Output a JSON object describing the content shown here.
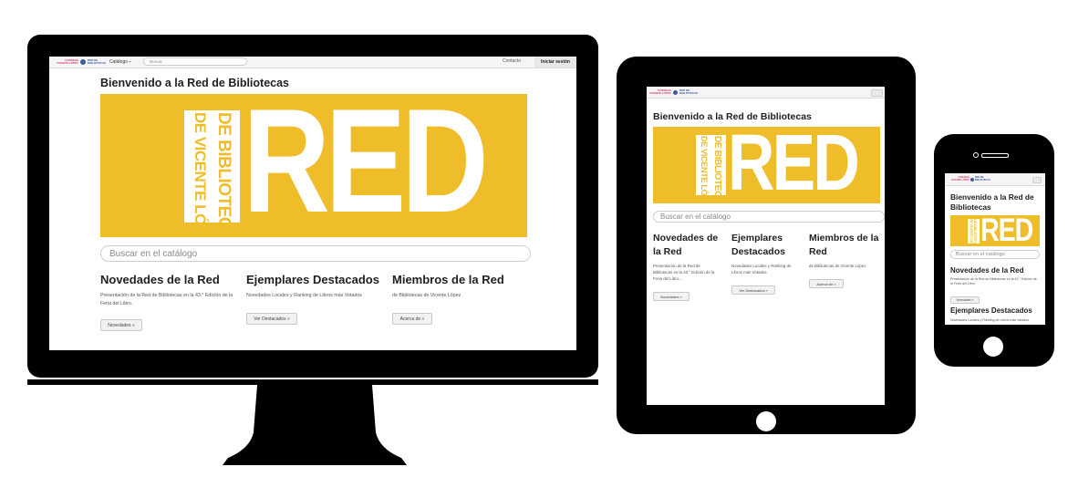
{
  "site": {
    "logo_line1": "CONSEJO",
    "logo_line2": "VICENTE LÓPEZ",
    "logo_line3": "RED DE",
    "logo_line4": "BIBLIOTECAS"
  },
  "navbar": {
    "catalog_label": "Catálogo",
    "search_placeholder": "Buscar",
    "contact_label": "Contacto",
    "login_label": "Iniciar sesión"
  },
  "page": {
    "title": "Bienvenido a la Red de Bibliotecas",
    "title_phone_1": "Bienvenido a la Red de",
    "title_phone_2": "Bibliotecas",
    "search_placeholder": "Buscar en el catálogo"
  },
  "banner": {
    "big_word": "RED",
    "line1": "DE BIBLIOTECAS",
    "line2": "DE VICENTE LÓPEZ",
    "color": "#f0bd2a"
  },
  "sections": [
    {
      "title": "Novedades de la Red",
      "title_split_1": "Novedades de",
      "title_split_2": "la Red",
      "text": "Presentación de la Red de Bibliotecas en la 43.° Edición de la Feria del Libro.",
      "text_tablet_1": "Presentación de la Red de",
      "text_tablet_2": "Bibliotecas en la 43.° Edición de la",
      "text_tablet_3": "Feria del Libro...",
      "button": "Novedades »"
    },
    {
      "title": "Ejemplares Destacados",
      "title_split_1": "Ejemplares",
      "title_split_2": "Destacados",
      "text": "Novedades Locales y Ranking de Libros más Votados",
      "text_tablet_1": "Novedades Locales y Ranking de",
      "text_tablet_2": "Libros más Votados",
      "button": "Ver Destacados »",
      "button_tablet": "Ver Destacados »"
    },
    {
      "title": "Miembros de la Red",
      "title_split_1": "Miembros de la",
      "title_split_2": "Red",
      "text": "de Bibliotecas de Vicente López",
      "button": "Acerca de »"
    }
  ],
  "icons": {
    "catalog_caret": "chevron-down-icon",
    "menu_toggle": "hamburger-icon",
    "home_button": "home-button-icon"
  }
}
